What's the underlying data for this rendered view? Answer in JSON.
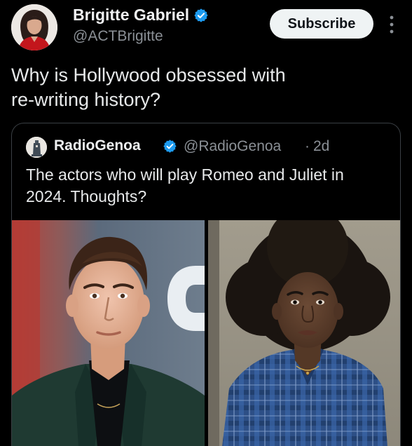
{
  "post": {
    "author_name": "Brigitte Gabriel",
    "author_handle": "@ACTBrigitte",
    "subscribe_label": "Subscribe",
    "text_lines": [
      "Why is Hollywood obsessed with",
      "re-writing history?"
    ]
  },
  "quoted": {
    "author_name": "RadioGenoa",
    "author_handle": "@RadioGenoa",
    "separator": "·",
    "time": "2d",
    "text_lines": [
      "The actors who will play Romeo and Juliet in",
      "2024. Thoughts?"
    ]
  },
  "icons": {
    "verified": "verified-badge-icon",
    "more": "more-vertical-icon"
  },
  "colors": {
    "background": "#000000",
    "verified_blue": "#1d9bf0",
    "handle_gray": "#8b9096",
    "subscribe_bg": "#eff3f4"
  }
}
